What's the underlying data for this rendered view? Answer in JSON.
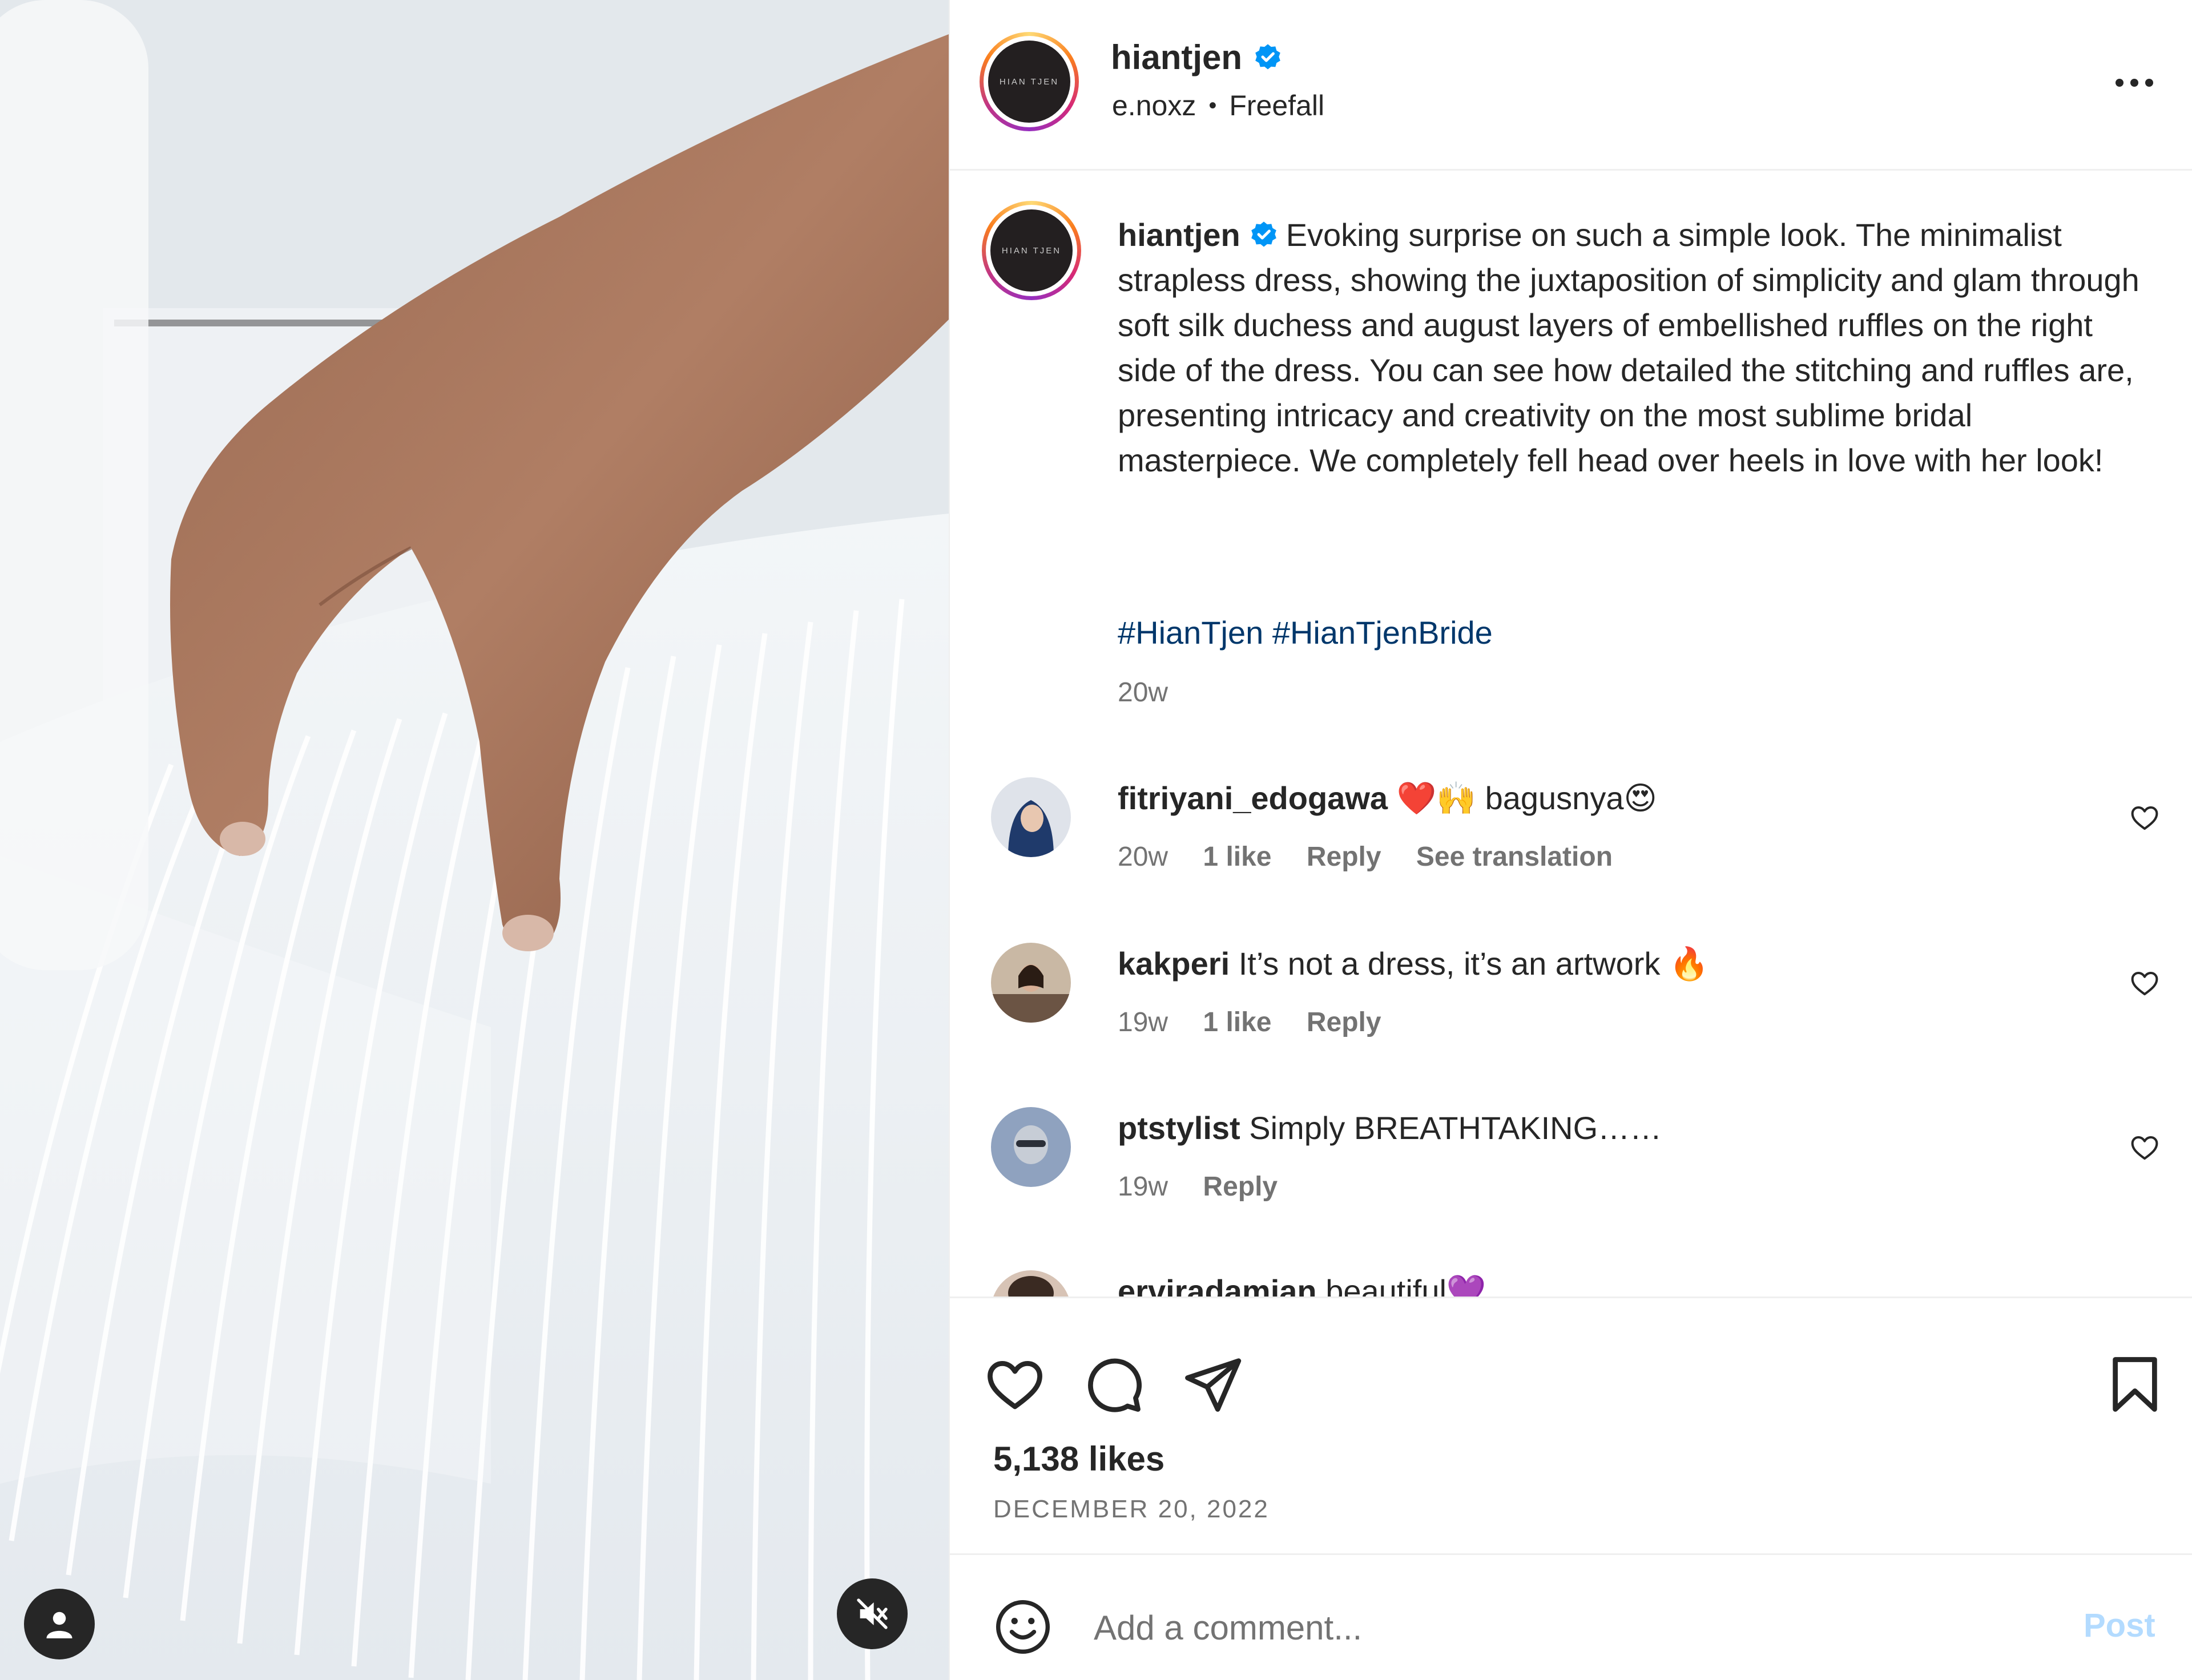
{
  "post": {
    "author": "hiantjen",
    "verified": true,
    "audio_artist": "e.noxz",
    "audio_separator": "•",
    "audio_track": "Freefall",
    "avatar_logo_text": "HIAN TJEN",
    "caption": "Evoking surprise on such a simple look. The minimalist strapless dress, showing the juxtaposition of simplicity and glam through soft silk duchess and august layers of embellished ruffles on the right side of the dress. You can see how detailed the stitching and ruffles are, presenting intricacy and creativity on the most sublime bridal masterpiece. We completely fell head over heels in love with her look!",
    "hashtags": [
      "#HianTjen",
      "#HianTjenBride"
    ],
    "caption_time": "20w",
    "likes": "5,138 likes",
    "date": "DECEMBER 20, 2022"
  },
  "comments": [
    {
      "user": "fitriyani_edogawa",
      "text": "❤️🙌 bagusnya😍",
      "time": "20w",
      "likes": "1 like",
      "reply": "Reply",
      "translate": "See translation"
    },
    {
      "user": "kakperi",
      "text": "It’s not a dress, it’s an artwork 🔥",
      "time": "19w",
      "likes": "1 like",
      "reply": "Reply"
    },
    {
      "user": "ptstylist",
      "text": "Simply BREATHTAKING……",
      "time": "19w",
      "reply": "Reply"
    },
    {
      "user": "erviradamian",
      "text": "beautiful💜"
    }
  ],
  "add_comment": {
    "placeholder": "Add a comment...",
    "post_label": "Post"
  },
  "icons": {
    "more": "more-options-icon",
    "like": "heart-icon",
    "comment": "comment-icon",
    "share": "share-icon",
    "save": "bookmark-icon",
    "emoji": "emoji-icon",
    "mute": "muted-speaker-icon",
    "tag": "user-icon"
  },
  "colors": {
    "verified": "#0095f6",
    "hashtag": "#00376b",
    "post_disabled": "#b3dbff",
    "muted_text": "#737373"
  }
}
